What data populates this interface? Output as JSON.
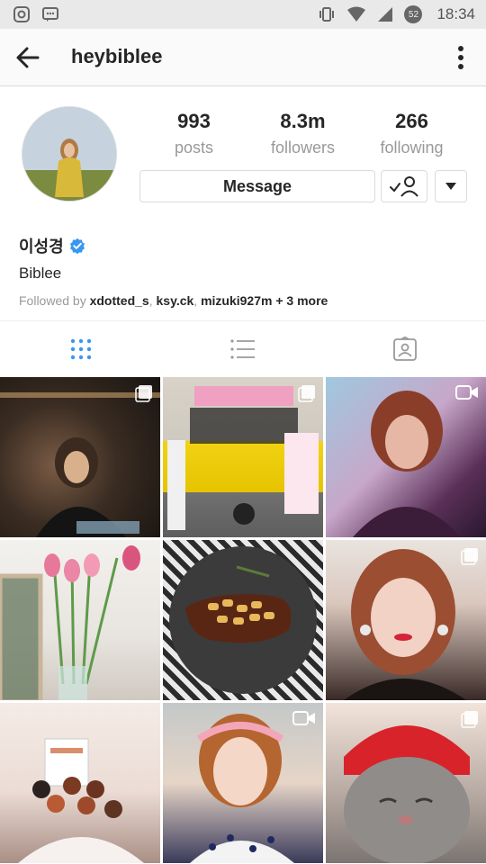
{
  "status_bar": {
    "time": "18:34",
    "battery": "52",
    "left_icons": [
      "instagram-notification-icon",
      "message-notification-icon"
    ],
    "right_icons": [
      "vibrate-icon",
      "wifi-icon",
      "signal-icon",
      "battery-icon"
    ]
  },
  "header": {
    "title": "heybiblee",
    "back_icon": "arrow-left-icon",
    "more_icon": "more-vertical-icon"
  },
  "profile": {
    "stats": [
      {
        "value": "993",
        "label": "posts"
      },
      {
        "value": "8.3m",
        "label": "followers"
      },
      {
        "value": "266",
        "label": "following"
      }
    ],
    "message_label": "Message",
    "name": "이성경",
    "subtitle": "Biblee",
    "followed_by_prefix": "Followed by",
    "followed_by_users": [
      "xdotted_s",
      "ksy.ck",
      "mizuki927m"
    ],
    "followed_by_suffix": "+ 3 more"
  },
  "tabs": [
    {
      "name": "grid",
      "icon": "grid-icon",
      "active": true
    },
    {
      "name": "list",
      "icon": "list-icon",
      "active": false
    },
    {
      "name": "tagged",
      "icon": "tagged-person-icon",
      "active": false
    }
  ],
  "grid": [
    {
      "type": "carousel"
    },
    {
      "type": "carousel"
    },
    {
      "type": "video"
    },
    {
      "type": "photo"
    },
    {
      "type": "photo"
    },
    {
      "type": "carousel"
    },
    {
      "type": "photo"
    },
    {
      "type": "video"
    },
    {
      "type": "carousel"
    }
  ],
  "colors": {
    "accent": "#3897f0",
    "text": "#262626",
    "muted": "#999999",
    "border": "#dbdbdb"
  }
}
